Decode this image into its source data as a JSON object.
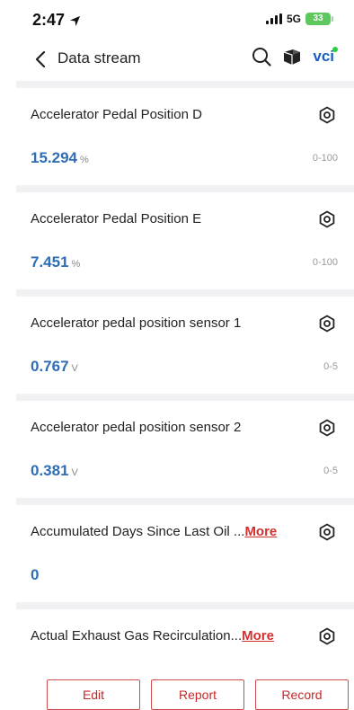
{
  "status_bar": {
    "time": "2:47",
    "network": "5G",
    "battery": "33"
  },
  "nav": {
    "title": "Data stream",
    "vci_label": "vci"
  },
  "items": [
    {
      "name": "Accelerator Pedal Position D",
      "value": "15.294",
      "unit": "%",
      "range": "0-100"
    },
    {
      "name": "Accelerator Pedal Position E",
      "value": "7.451",
      "unit": "%",
      "range": "0-100"
    },
    {
      "name": "Accelerator pedal position sensor 1",
      "value": "0.767",
      "unit": "V",
      "range": "0-5"
    },
    {
      "name": "Accelerator pedal position sensor 2",
      "value": "0.381",
      "unit": "V",
      "range": "0-5"
    },
    {
      "name": "Accumulated Days Since Last Oil ...",
      "more": "More",
      "value": "0"
    },
    {
      "name": "Actual Exhaust Gas Recirculation...",
      "more": "More"
    }
  ],
  "buttons": {
    "edit": "Edit",
    "report": "Report",
    "record": "Record"
  },
  "colors": {
    "value_blue": "#2f6db5",
    "accent_red": "#c62828",
    "vci_blue": "#1b5fbf",
    "battery_green": "#5cc85e"
  }
}
